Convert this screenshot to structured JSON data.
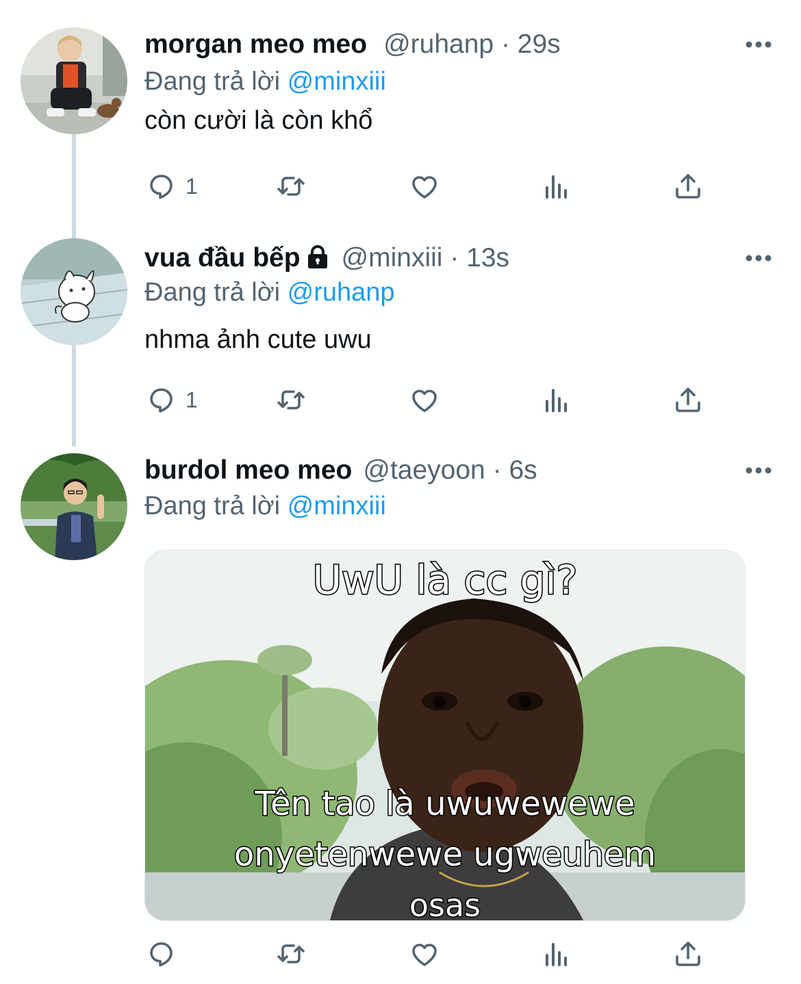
{
  "tweets": [
    {
      "name": "morgan meo meo",
      "handle": "@ruhanp",
      "separator": "·",
      "time": "29s",
      "reply_prefix": "Đang trả lời",
      "reply_to": "@minxiii",
      "text": "còn cười là còn khổ",
      "reply_count": "1"
    },
    {
      "name": "vua đầu bếp",
      "handle": "@minxiii",
      "separator": "·",
      "time": "13s",
      "reply_prefix": "Đang trả lời",
      "reply_to": "@ruhanp",
      "text": "nhma ảnh cute uwu",
      "reply_count": "1",
      "protected_icon": "lock-icon"
    },
    {
      "name": "burdol meo meo",
      "handle": "@taeyoon",
      "separator": "·",
      "time": "6s",
      "reply_prefix": "Đang trả lời",
      "reply_to": "@minxiii",
      "media_caption_top": "UwU là cc gì?",
      "media_caption_bottom_1": "Tên tao là uwuwewewe",
      "media_caption_bottom_2": "onyetenwewe ugweuhem",
      "media_caption_bottom_3": "osas"
    }
  ],
  "icons": [
    "reply-icon",
    "retweet-icon",
    "like-icon",
    "analytics-icon",
    "share-icon",
    "more-icon"
  ],
  "colors": {
    "text": "#0f1419",
    "secondary": "#536471",
    "accent": "#1d9bf0",
    "thread_line": "#cfd9de"
  }
}
